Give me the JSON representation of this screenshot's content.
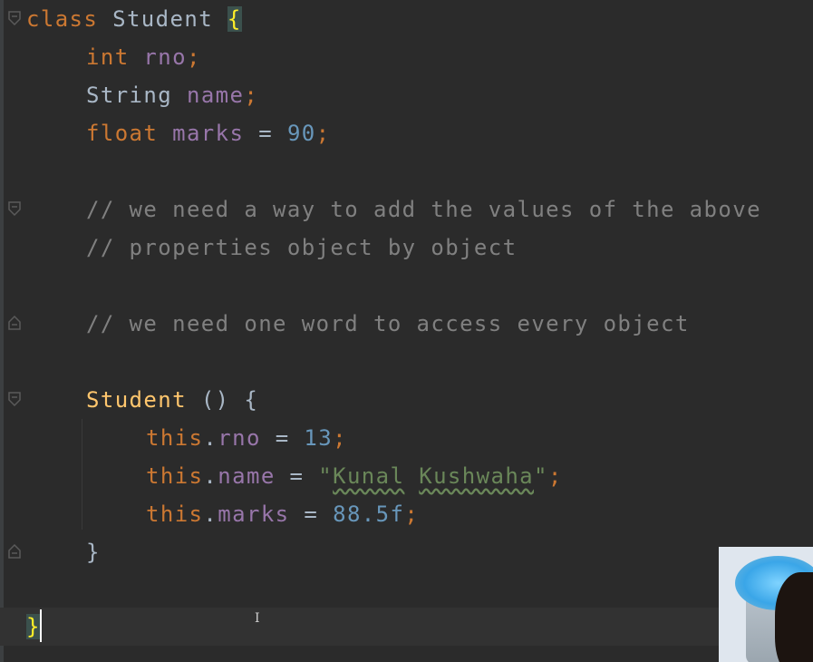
{
  "editor": {
    "lines": {
      "l1": {
        "kw": "class",
        "name": "Student",
        "brace": "{"
      },
      "l2": {
        "type": "int",
        "field": "rno",
        "semi": ";"
      },
      "l3": {
        "type": "String",
        "field": "name",
        "semi": ";"
      },
      "l4": {
        "type": "float",
        "field": "marks",
        "op": "=",
        "value": "90",
        "semi": ";"
      },
      "l6": {
        "text": "// we need a way to add the values of the above"
      },
      "l7": {
        "text": "// properties object by object"
      },
      "l9": {
        "text": "// we need one word to access every object"
      },
      "l11": {
        "name": "Student",
        "params": "()",
        "brace": "{"
      },
      "l12": {
        "kw": "this",
        "dot": ".",
        "field": "rno",
        "op": "=",
        "value": "13",
        "semi": ";"
      },
      "l13": {
        "kw": "this",
        "dot": ".",
        "field": "name",
        "op": "=",
        "quote_open": "\"",
        "word1": "Kunal",
        "word2": "Kushwaha",
        "quote_close": "\"",
        "semi": ";"
      },
      "l14": {
        "kw": "this",
        "dot": ".",
        "field": "marks",
        "op": "=",
        "value": "88.5f",
        "semi": ";"
      },
      "l15": {
        "brace": "}"
      },
      "l17": {
        "brace": "}"
      }
    }
  },
  "colors": {
    "background": "#2b2b2b",
    "keyword": "#cc7832",
    "field": "#9876aa",
    "number": "#6897bb",
    "string": "#6a8759",
    "comment": "#808080",
    "method": "#ffc66d",
    "plain": "#a9b7c6",
    "brace_highlight": "#ffef28"
  },
  "icons": {
    "fold": "fold-marker-icon",
    "cursor": "text-cursor-icon"
  }
}
